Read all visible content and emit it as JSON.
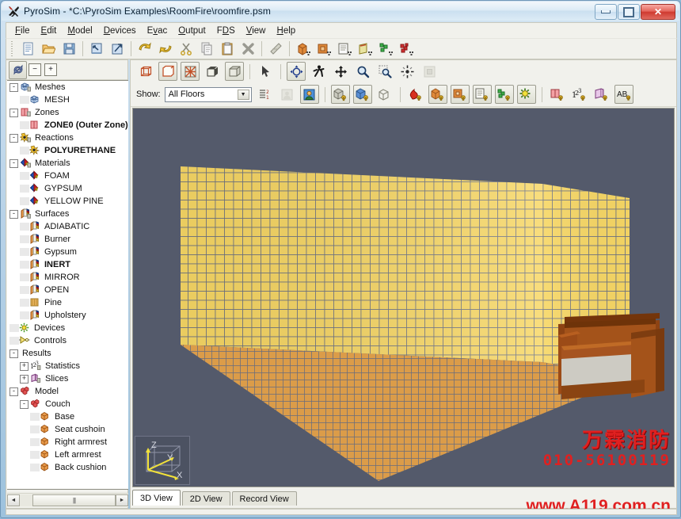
{
  "window": {
    "title": "PyroSim - *C:\\PyroSim Examples\\RoomFire\\roomfire.psm",
    "app_icon": "pyrosim-logo-icon",
    "buttons": {
      "minimize": "minimize-icon",
      "maximize": "maximize-icon",
      "close": "✕"
    }
  },
  "menu": [
    {
      "label": "File",
      "accel": "F"
    },
    {
      "label": "Edit",
      "accel": "E"
    },
    {
      "label": "Model",
      "accel": "M"
    },
    {
      "label": "Devices",
      "accel": "D"
    },
    {
      "label": "Evac",
      "accel": "v"
    },
    {
      "label": "Output",
      "accel": "O"
    },
    {
      "label": "FDS",
      "accel": "D"
    },
    {
      "label": "View",
      "accel": "V"
    },
    {
      "label": "Help",
      "accel": "H"
    }
  ],
  "main_toolbar": [
    {
      "name": "new-file-icon",
      "title": "New"
    },
    {
      "name": "open-folder-icon",
      "title": "Open"
    },
    {
      "name": "save-disk-icon",
      "title": "Save"
    },
    {
      "name": "import-icon",
      "title": "Import"
    },
    {
      "name": "export-icon",
      "title": "Export"
    },
    {
      "name": "undo-icon",
      "title": "Undo"
    },
    {
      "name": "redo-icon",
      "title": "Redo"
    },
    {
      "name": "cut-scissors-icon",
      "title": "Cut"
    },
    {
      "name": "copy-icon",
      "title": "Copy"
    },
    {
      "name": "paste-icon",
      "title": "Paste"
    },
    {
      "name": "delete-x-icon",
      "title": "Delete"
    },
    {
      "name": "edit-note-icon",
      "title": "Edit"
    },
    {
      "name": "new-obstruction-icon",
      "title": "New Obstruction"
    },
    {
      "name": "new-hole-icon",
      "title": "New Hole"
    },
    {
      "name": "new-vent-icon",
      "title": "New Vent"
    },
    {
      "name": "new-slice-icon",
      "title": "New Slice"
    },
    {
      "name": "new-device-icon",
      "title": "New Device"
    },
    {
      "name": "new-particle-icon",
      "title": "New Particle"
    }
  ],
  "tree_panel": {
    "toolbar": {
      "navigation_button": "tree-navigation-icon",
      "collapse_all": "−",
      "expand_all": "+"
    },
    "items": [
      {
        "label": "Meshes",
        "icon": "mesh-group-icon",
        "indent": 0,
        "expander": "-",
        "bold": false
      },
      {
        "label": "MESH",
        "icon": "mesh-icon",
        "indent": 1,
        "expander": "",
        "bold": false
      },
      {
        "label": "Zones",
        "icon": "zone-group-icon",
        "indent": 0,
        "expander": "-",
        "bold": false
      },
      {
        "label": "ZONE0 (Outer Zone)",
        "icon": "zone-icon",
        "indent": 1,
        "expander": "",
        "bold": true
      },
      {
        "label": "Reactions",
        "icon": "reaction-group-icon",
        "indent": 0,
        "expander": "-",
        "bold": false
      },
      {
        "label": "POLYURETHANE",
        "icon": "reaction-icon",
        "indent": 1,
        "expander": "",
        "bold": true
      },
      {
        "label": "Materials",
        "icon": "material-group-icon",
        "indent": 0,
        "expander": "-",
        "bold": false
      },
      {
        "label": "FOAM",
        "icon": "material-icon",
        "indent": 1,
        "expander": "",
        "bold": false
      },
      {
        "label": "GYPSUM",
        "icon": "material-icon",
        "indent": 1,
        "expander": "",
        "bold": false
      },
      {
        "label": "YELLOW PINE",
        "icon": "material-icon",
        "indent": 1,
        "expander": "",
        "bold": false
      },
      {
        "label": "Surfaces",
        "icon": "surface-group-icon",
        "indent": 0,
        "expander": "-",
        "bold": false
      },
      {
        "label": "ADIABATIC",
        "icon": "surface-icon",
        "indent": 1,
        "expander": "",
        "bold": false
      },
      {
        "label": "Burner",
        "icon": "surface-icon",
        "indent": 1,
        "expander": "",
        "bold": false
      },
      {
        "label": "Gypsum",
        "icon": "surface-icon",
        "indent": 1,
        "expander": "",
        "bold": false
      },
      {
        "label": "INERT",
        "icon": "surface-icon",
        "indent": 1,
        "expander": "",
        "bold": true
      },
      {
        "label": "MIRROR",
        "icon": "surface-icon",
        "indent": 1,
        "expander": "",
        "bold": false
      },
      {
        "label": "OPEN",
        "icon": "surface-icon",
        "indent": 1,
        "expander": "",
        "bold": false
      },
      {
        "label": "Pine",
        "icon": "surface-pine-icon",
        "indent": 1,
        "expander": "",
        "bold": false
      },
      {
        "label": "Upholstery",
        "icon": "surface-icon",
        "indent": 1,
        "expander": "",
        "bold": false
      },
      {
        "label": "Devices",
        "icon": "devices-icon",
        "indent": 0,
        "expander": "",
        "bold": false
      },
      {
        "label": "Controls",
        "icon": "controls-icon",
        "indent": 0,
        "expander": "",
        "bold": false
      },
      {
        "label": "Results",
        "icon": "",
        "indent": 0,
        "expander": "-",
        "bold": false
      },
      {
        "label": "Statistics",
        "icon": "statistics-icon",
        "indent": 1,
        "expander": "+",
        "bold": false
      },
      {
        "label": "Slices",
        "icon": "slices-icon",
        "indent": 1,
        "expander": "+",
        "bold": false
      },
      {
        "label": "Model",
        "icon": "model-icon",
        "indent": 0,
        "expander": "-",
        "bold": false
      },
      {
        "label": "Couch",
        "icon": "group-icon",
        "indent": 1,
        "expander": "-",
        "bold": false
      },
      {
        "label": "Base",
        "icon": "obstruction-icon",
        "indent": 2,
        "expander": "",
        "bold": false
      },
      {
        "label": "Seat cushoin",
        "icon": "obstruction-icon",
        "indent": 2,
        "expander": "",
        "bold": false
      },
      {
        "label": "Right armrest",
        "icon": "obstruction-icon",
        "indent": 2,
        "expander": "",
        "bold": false
      },
      {
        "label": "Left armrest",
        "icon": "obstruction-icon",
        "indent": 2,
        "expander": "",
        "bold": false
      },
      {
        "label": "Back cushion",
        "icon": "obstruction-icon",
        "indent": 2,
        "expander": "",
        "bold": false
      }
    ],
    "hscroll": {
      "left_arrow": "◄",
      "right_arrow": "►",
      "thumb_grip": "|||"
    }
  },
  "view_toolbar_row1": [
    {
      "name": "wireframe-view-icon",
      "pressed": false
    },
    {
      "name": "outline-view-icon",
      "pressed": true
    },
    {
      "name": "textured-view-icon",
      "pressed": true
    },
    {
      "name": "solid-view-icon",
      "pressed": false
    },
    {
      "name": "shaded-view-icon",
      "pressed": true
    },
    {
      "name": "select-arrow-icon",
      "pressed": false
    },
    {
      "name": "orbit-icon",
      "pressed": true
    },
    {
      "name": "walk-icon",
      "pressed": false
    },
    {
      "name": "pan-icon",
      "pressed": false
    },
    {
      "name": "zoom-icon",
      "pressed": false
    },
    {
      "name": "zoom-region-icon",
      "pressed": false
    },
    {
      "name": "center-view-icon",
      "pressed": false
    },
    {
      "name": "reset-view-icon",
      "pressed": false,
      "disabled": true
    }
  ],
  "view_toolbar_row2": {
    "show_label": "Show:",
    "floor_select": {
      "value": "All Floors",
      "arrow": "▼"
    },
    "buttons": [
      {
        "name": "reorder-floors-icon",
        "pressed": false,
        "disabled": false
      },
      {
        "name": "person-view-icon",
        "pressed": false,
        "disabled": true
      },
      {
        "name": "person-color-view-icon",
        "pressed": true,
        "disabled": false
      },
      {
        "name": "show-mesh-grid-icon",
        "pressed": true,
        "disabled": false
      },
      {
        "name": "show-mesh-solid-icon",
        "pressed": true,
        "disabled": false
      },
      {
        "name": "show-bounds-icon",
        "pressed": false,
        "disabled": false
      },
      {
        "name": "show-reactions-icon",
        "pressed": false,
        "disabled": false
      },
      {
        "name": "show-obstructions-icon",
        "pressed": true,
        "disabled": false
      },
      {
        "name": "show-holes-icon",
        "pressed": true,
        "disabled": false
      },
      {
        "name": "show-vents-icon",
        "pressed": true,
        "disabled": false
      },
      {
        "name": "show-particles-icon",
        "pressed": true,
        "disabled": false
      },
      {
        "name": "show-devices-icon",
        "pressed": true,
        "disabled": false
      },
      {
        "name": "show-zones-icon",
        "pressed": false,
        "disabled": false
      },
      {
        "name": "show-statistics-icon",
        "pressed": false,
        "disabled": false
      },
      {
        "name": "show-slices-icon",
        "pressed": false,
        "disabled": false
      },
      {
        "name": "show-labels-icon",
        "pressed": true,
        "disabled": false,
        "text": "AB"
      }
    ]
  },
  "viewport": {
    "background_color": "#545a6b",
    "wall_color": "#f6d665",
    "floor_color": "#e09f47",
    "mesh_line_color": "#6b7183",
    "couch": {
      "frame_color": "#9c4b17",
      "back_color": "#7e3a10",
      "cushion_color": "#c9c7bf",
      "seat_color": "#a0531b"
    },
    "axis_indicator": {
      "x_label": "X",
      "y_label": "Y",
      "z_label": "Z",
      "axis_color": "#f2e23a",
      "box_color": "#9aa0b2"
    },
    "watermark": {
      "line1": "万霖消防",
      "line2": "010-56100119",
      "line3": "www.A119.com.cn",
      "color": "#e02020"
    }
  },
  "view_tabs": [
    {
      "label": "3D View",
      "active": true
    },
    {
      "label": "2D View",
      "active": false
    },
    {
      "label": "Record View",
      "active": false
    }
  ]
}
